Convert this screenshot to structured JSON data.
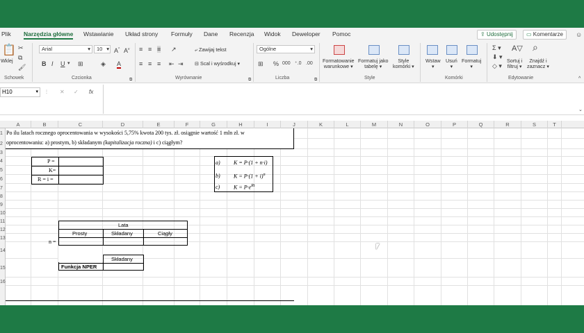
{
  "tabs": [
    "Plik",
    "Narzędzia główne",
    "Wstawianie",
    "Układ strony",
    "Formuły",
    "Dane",
    "Recenzja",
    "Widok",
    "Deweloper",
    "Pomoc"
  ],
  "share_label": "Udostępnij",
  "comments_label": "Komentarze",
  "ribbon": {
    "paste_label": "Wklej",
    "font_name": "Arial",
    "font_size": "10",
    "wrap_label": "Zawijaj tekst",
    "merge_label": "Scal i wyśrodkuj",
    "number_format": "Ogólne",
    "cond_format": [
      "Formatowanie",
      "warunkowe"
    ],
    "format_table": [
      "Formatuj jako",
      "tabelę"
    ],
    "cell_styles": [
      "Style",
      "komórki"
    ],
    "insert_label": "Wstaw",
    "delete_label": "Usuń",
    "format_label": "Formatuj",
    "sort_label": [
      "Sortuj i",
      "filtruj"
    ],
    "find_label": [
      "Znajdź i",
      "zaznacz"
    ],
    "groups": {
      "clipboard": "Schowek",
      "font": "Czcionka",
      "alignment": "Wyrównanie",
      "number": "Liczba",
      "styles": "Style",
      "cells": "Komórki",
      "editing": "Edytowanie"
    }
  },
  "namebox": "H10",
  "fx_label": "fx",
  "columns": [
    "A",
    "B",
    "C",
    "D",
    "E",
    "F",
    "G",
    "H",
    "I",
    "J",
    "K",
    "L",
    "M",
    "N",
    "O",
    "P",
    "Q",
    "R",
    "S",
    "T"
  ],
  "rows": [
    "1",
    "2",
    "3",
    "4",
    "5",
    "6",
    "7",
    "8",
    "9",
    "10",
    "11",
    "12",
    "13",
    "14",
    "15",
    "16"
  ],
  "sheet": {
    "question_line1": "Po ilu latach rocznego oprocentowania w wysokości 5,75% kwota 200 tys. zł. osiągnie wartość 1 mln zł. w",
    "question_line2_a": "oprocentowaniu: a) prostym, b) składanym ",
    "question_line2_italic": "(kapitalizacja roczna)",
    "question_line2_b": "  i c) ciągłym?",
    "p_label": "P =",
    "k_label": "K=",
    "r_label": "R = i =",
    "lata": "Lata",
    "prosty": "Prosty",
    "skladany": "Składany",
    "ciagly": "Ciągły",
    "n_label": "n =",
    "skladany2": "Składany",
    "nper": "Funkcja NPER",
    "formulas": [
      {
        "tag": "a)",
        "expr": "K = P·(1 + n·i)"
      },
      {
        "tag": "b)",
        "expr": "K = P·(1 + i)",
        "sup": "n"
      },
      {
        "tag": "c)",
        "expr": "K = P·e",
        "sup": "Rt"
      }
    ]
  }
}
